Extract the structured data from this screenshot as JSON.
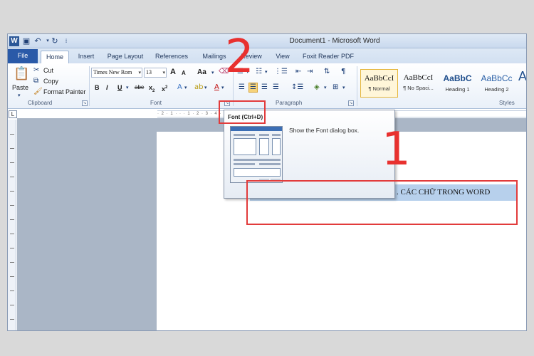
{
  "window": {
    "title": "Document1 - Microsoft Word",
    "logo": "W"
  },
  "tabs": [
    {
      "label": "File"
    },
    {
      "label": "Home"
    },
    {
      "label": "Insert"
    },
    {
      "label": "Page Layout"
    },
    {
      "label": "References"
    },
    {
      "label": "Mailings"
    },
    {
      "label": "Review"
    },
    {
      "label": "View"
    },
    {
      "label": "Foxit Reader PDF"
    }
  ],
  "clipboard": {
    "paste": "Paste",
    "cut": "Cut",
    "copy": "Copy",
    "format_painter": "Format Painter",
    "label": "Clipboard"
  },
  "font": {
    "font_name": "Times New Rom",
    "font_size": "13",
    "grow": "A",
    "shrink": "A",
    "change_case": "Aa",
    "bold": "B",
    "italic": "I",
    "underline": "U",
    "strikethrough": "abe",
    "subscript": "x",
    "superscript": "x",
    "label": "Font"
  },
  "paragraph": {
    "label": "Paragraph"
  },
  "styles": {
    "label": "Styles",
    "items": [
      {
        "preview": "AaBbCcI",
        "name": "¶ Normal"
      },
      {
        "preview": "AaBbCcI",
        "name": "¶ No Spaci..."
      },
      {
        "preview": "AaBbC",
        "name": "Heading 1"
      },
      {
        "preview": "AaBbCc",
        "name": "Heading 2"
      },
      {
        "preview": "A",
        "name": ""
      }
    ]
  },
  "ruler": {
    "button": "L",
    "ticks": "· 2 · 1 · · · 1 · 2 · 3 · 4 · 5 · 6 · 7 · 8 · 9 · 10 · 11 · 12 · 13 · 14 · 15 · 16 · 1"
  },
  "tooltip": {
    "title": "Font (Ctrl+D)",
    "description": "Show the Font dialog box."
  },
  "document": {
    "selected_text": ". CÁC CHỮ TRONG WORD"
  },
  "annotations": {
    "step_one": "1",
    "step_two": "2"
  }
}
